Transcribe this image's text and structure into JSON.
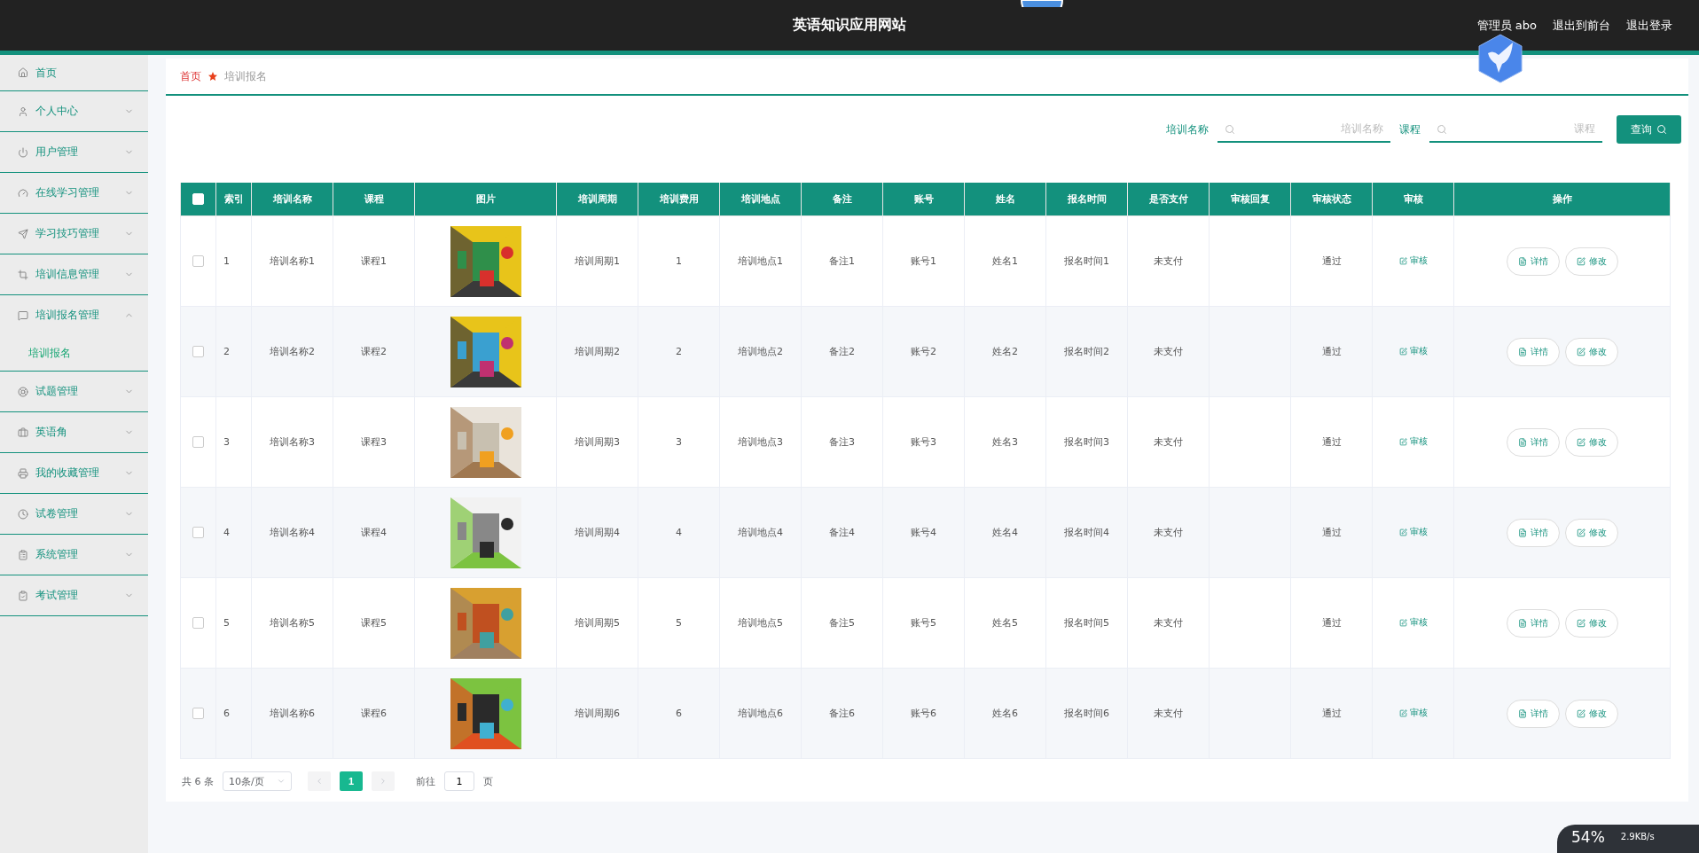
{
  "header": {
    "title": "英语知识应用网站",
    "user": "管理员 abo",
    "links": [
      "退出到前台",
      "退出登录"
    ]
  },
  "sidebar": {
    "items": [
      {
        "label": "首页",
        "kind": "link"
      },
      {
        "label": "个人中心",
        "kind": "group",
        "expanded": false
      },
      {
        "label": "用户管理",
        "kind": "group",
        "expanded": false
      },
      {
        "label": "在线学习管理",
        "kind": "group",
        "expanded": false
      },
      {
        "label": "学习技巧管理",
        "kind": "group",
        "expanded": false
      },
      {
        "label": "培训信息管理",
        "kind": "group",
        "expanded": false
      },
      {
        "label": "培训报名管理",
        "kind": "group",
        "expanded": true,
        "children": [
          {
            "label": "培训报名",
            "selected": true
          }
        ]
      },
      {
        "label": "试题管理",
        "kind": "group",
        "expanded": false
      },
      {
        "label": "英语角",
        "kind": "group",
        "expanded": false
      },
      {
        "label": "我的收藏管理",
        "kind": "group",
        "expanded": false
      },
      {
        "label": "试卷管理",
        "kind": "group",
        "expanded": false
      },
      {
        "label": "系统管理",
        "kind": "group",
        "expanded": false
      },
      {
        "label": "考试管理",
        "kind": "group",
        "expanded": false
      }
    ]
  },
  "breadcrumb": [
    "首页",
    "培训报名"
  ],
  "search": {
    "fields": [
      {
        "label": "培训名称",
        "placeholder": "培训名称"
      },
      {
        "label": "课程",
        "placeholder": "课程"
      }
    ],
    "button": "查询"
  },
  "table": {
    "all_checked": false,
    "columns": [
      {
        "label": "索引",
        "kind": "text"
      },
      {
        "label": "培训名称",
        "kind": "text"
      },
      {
        "label": "课程",
        "kind": "text"
      },
      {
        "label": "图片",
        "kind": "picture"
      },
      {
        "label": "培训周期",
        "kind": "text"
      },
      {
        "label": "培训费用",
        "kind": "text"
      },
      {
        "label": "培训地点",
        "kind": "text"
      },
      {
        "label": "备注",
        "kind": "text"
      },
      {
        "label": "账号",
        "kind": "text"
      },
      {
        "label": "姓名",
        "kind": "text"
      },
      {
        "label": "报名时间",
        "kind": "text"
      },
      {
        "label": "是否支付",
        "kind": "text"
      },
      {
        "label": "审核回复",
        "kind": "text"
      },
      {
        "label": "审核状态",
        "kind": "text"
      },
      {
        "label": "审核",
        "kind": "link"
      },
      {
        "label": "操作",
        "kind": "actions"
      }
    ],
    "rows": [
      {
        "checked": false,
        "cells": [
          "1",
          "培训名称1",
          "课程1",
          {
            "kind": "picture"
          },
          "培训周期1",
          "1",
          "培训地点1",
          "备注1",
          "账号1",
          "姓名1",
          "报名时间1",
          "未支付",
          null,
          "通过",
          "审核",
          [
            "详情",
            "修改"
          ]
        ]
      },
      {
        "checked": false,
        "cells": [
          "2",
          "培训名称2",
          "课程2",
          {
            "kind": "picture"
          },
          "培训周期2",
          "2",
          "培训地点2",
          "备注2",
          "账号2",
          "姓名2",
          "报名时间2",
          "未支付",
          null,
          "通过",
          "审核",
          [
            "详情",
            "修改"
          ]
        ]
      },
      {
        "checked": false,
        "cells": [
          "3",
          "培训名称3",
          "课程3",
          {
            "kind": "picture"
          },
          "培训周期3",
          "3",
          "培训地点3",
          "备注3",
          "账号3",
          "姓名3",
          "报名时间3",
          "未支付",
          null,
          "通过",
          "审核",
          [
            "详情",
            "修改"
          ]
        ]
      },
      {
        "checked": false,
        "cells": [
          "4",
          "培训名称4",
          "课程4",
          {
            "kind": "picture"
          },
          "培训周期4",
          "4",
          "培训地点4",
          "备注4",
          "账号4",
          "姓名4",
          "报名时间4",
          "未支付",
          null,
          "通过",
          "审核",
          [
            "详情",
            "修改"
          ]
        ]
      },
      {
        "checked": false,
        "cells": [
          "5",
          "培训名称5",
          "课程5",
          {
            "kind": "picture"
          },
          "培训周期5",
          "5",
          "培训地点5",
          "备注5",
          "账号5",
          "姓名5",
          "报名时间5",
          "未支付",
          null,
          "通过",
          "审核",
          [
            "详情",
            "修改"
          ]
        ]
      },
      {
        "checked": false,
        "cells": [
          "6",
          "培训名称6",
          "课程6",
          {
            "kind": "picture"
          },
          "培训周期6",
          "6",
          "培训地点6",
          "备注6",
          "账号6",
          "姓名6",
          "报名时间6",
          "未支付",
          null,
          "通过",
          "审核",
          [
            "详情",
            "修改"
          ]
        ]
      }
    ]
  },
  "pagination": {
    "total": "共 6 条",
    "page_size": "10条/页",
    "pages": [
      {
        "label": "1",
        "selected": true
      }
    ],
    "goto_label": "前往",
    "goto_value": "1",
    "goto_suffix": "页"
  },
  "speed_widget": {
    "percent": "54%",
    "speed": "2.9KB/s"
  }
}
